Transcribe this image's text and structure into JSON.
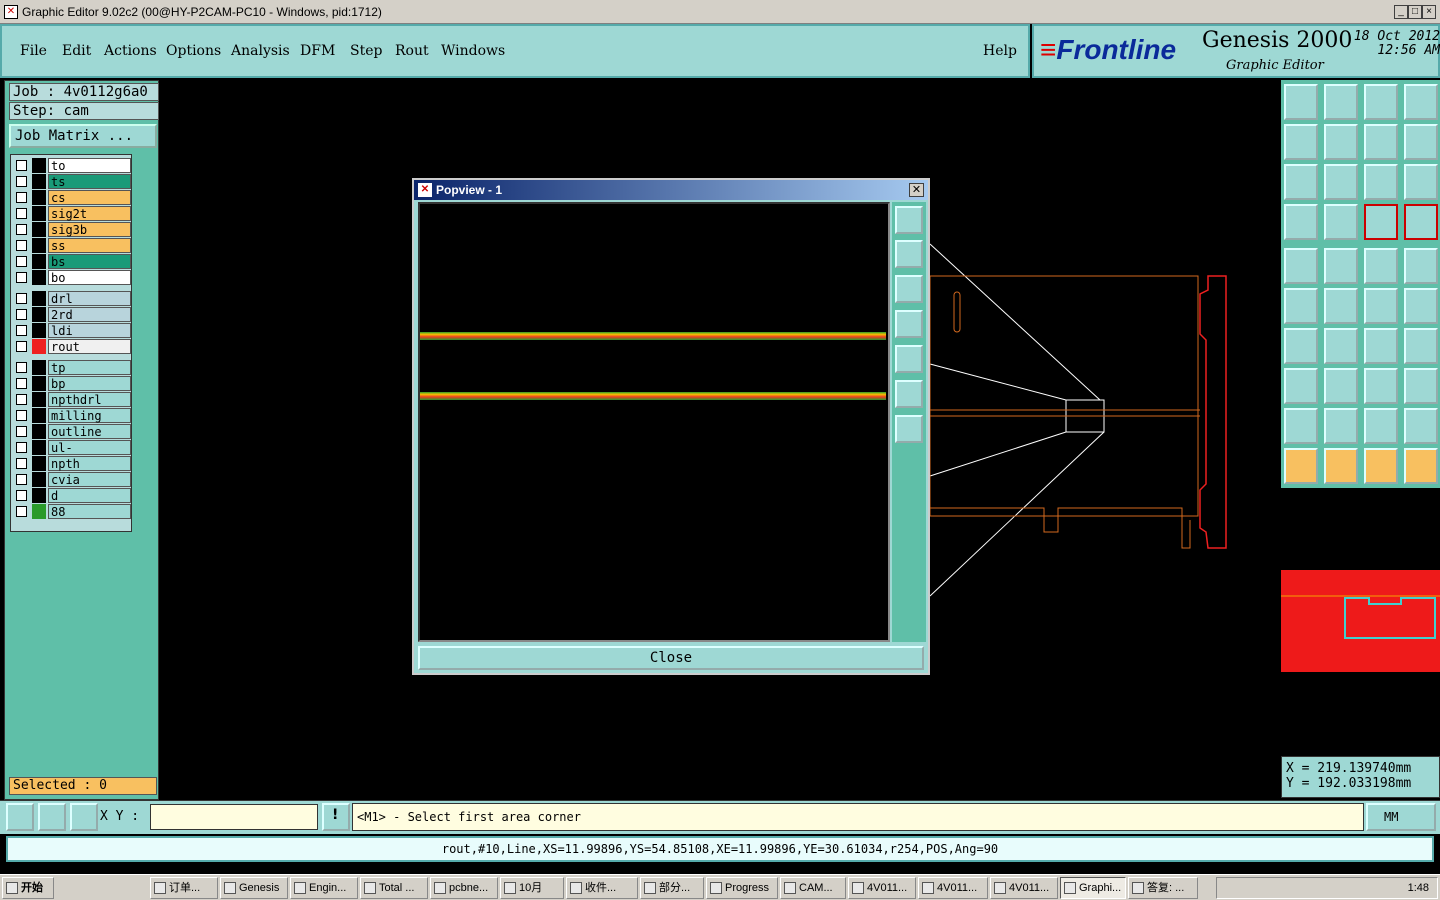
{
  "window": {
    "title": "Graphic Editor 9.02c2 (00@HY-P2CAM-PC10 - Windows, pid:1712)",
    "min": "_",
    "max": "□",
    "close": "×"
  },
  "menu": {
    "items": [
      "File",
      "Edit",
      "Actions",
      "Options",
      "Analysis",
      "DFM",
      "Step",
      "Rout",
      "Windows"
    ],
    "help": "Help"
  },
  "brand": {
    "logo": "Frontline",
    "product": "Genesis 2000",
    "subtitle": "Graphic Editor",
    "date": "18 Oct 2012",
    "time": "12:56 AM"
  },
  "left": {
    "job": "Job : 4v0112g6a0",
    "step": "Step: cam",
    "job_matrix": "Job Matrix ...",
    "layers": [
      {
        "name": "to",
        "bg": "#ffffff",
        "swatch": "#000000"
      },
      {
        "name": "ts",
        "bg": "#1a9a78",
        "swatch": "#000000"
      },
      {
        "name": "cs",
        "bg": "#f8c060",
        "swatch": "#000000"
      },
      {
        "name": "sig2t",
        "bg": "#f8c060",
        "swatch": "#000000"
      },
      {
        "name": "sig3b",
        "bg": "#f8c060",
        "swatch": "#000000"
      },
      {
        "name": "ss",
        "bg": "#f8c060",
        "swatch": "#000000"
      },
      {
        "name": "bs",
        "bg": "#1a9a78",
        "swatch": "#000000"
      },
      {
        "name": "bo",
        "bg": "#ffffff",
        "swatch": "#000000"
      },
      {
        "name": "drl",
        "bg": "#b8d4dc",
        "swatch": "#000000"
      },
      {
        "name": "2rd",
        "bg": "#b8d4dc",
        "swatch": "#000000"
      },
      {
        "name": "ldi",
        "bg": "#b8d4dc",
        "swatch": "#000000"
      },
      {
        "name": "rout",
        "bg": "#f0f0f0",
        "swatch": "#ee2020"
      },
      {
        "name": "tp",
        "bg": "#9ed8d4",
        "swatch": "#000000"
      },
      {
        "name": "bp",
        "bg": "#9ed8d4",
        "swatch": "#000000"
      },
      {
        "name": "npthdrl",
        "bg": "#9ed8d4",
        "swatch": "#000000"
      },
      {
        "name": "milling",
        "bg": "#9ed8d4",
        "swatch": "#000000"
      },
      {
        "name": "outline",
        "bg": "#9ed8d4",
        "swatch": "#000000"
      },
      {
        "name": "ul-position",
        "bg": "#9ed8d4",
        "swatch": "#000000"
      },
      {
        "name": "npth",
        "bg": "#9ed8d4",
        "swatch": "#000000"
      },
      {
        "name": "cvia",
        "bg": "#9ed8d4",
        "swatch": "#000000"
      },
      {
        "name": "d",
        "bg": "#9ed8d4",
        "swatch": "#000000"
      },
      {
        "name": "88",
        "bg": "#9ed8d4",
        "swatch": "#2a9a2a"
      }
    ],
    "selected": "Selected : 0"
  },
  "popview": {
    "title": "Popview - 1",
    "close": "Close"
  },
  "coords": {
    "x": "X  =  219.139740mm",
    "y": "Y  =  192.033198mm"
  },
  "bottom": {
    "xy_label": "X Y :",
    "message": "<M1> - Select first area corner",
    "units": "MM"
  },
  "status": "rout,#10,Line,XS=11.99896,YS=54.85108,XE=11.99896,YE=30.61034,r254,POS,Ang=90",
  "taskbar": {
    "start": "开始",
    "tasks": [
      "订单...",
      "Genesis",
      "Engin...",
      "Total ...",
      "pcbne...",
      "10月",
      "收件...",
      "部分...",
      "Progress",
      "CAM...",
      "4V011...",
      "4V011...",
      "4V011...",
      "Graphi...",
      "答复: ..."
    ],
    "clock": "1:48"
  }
}
